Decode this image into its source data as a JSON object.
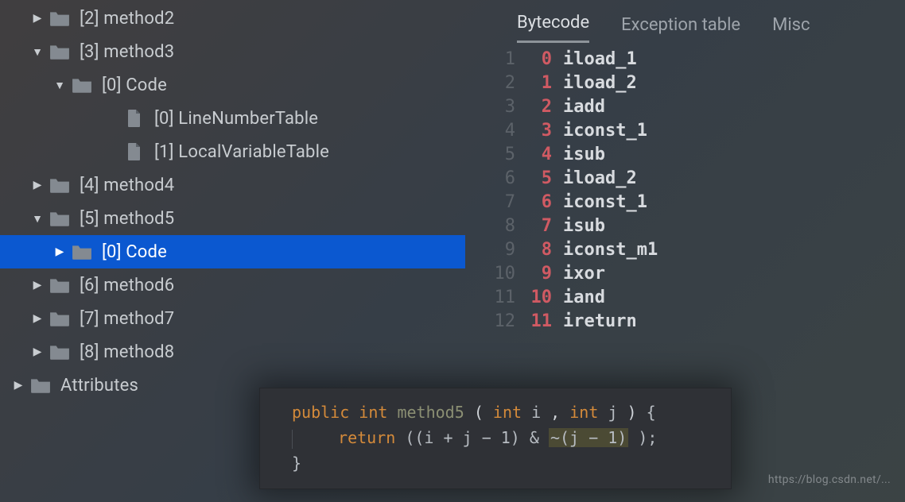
{
  "tree": {
    "rows": [
      {
        "indent": 1,
        "arrow": "right",
        "icon": "folder",
        "label": "[2] method2",
        "selected": false
      },
      {
        "indent": 1,
        "arrow": "down",
        "icon": "folder",
        "label": "[3] method3",
        "selected": false
      },
      {
        "indent": 2,
        "arrow": "down",
        "icon": "folder",
        "label": "[0] Code",
        "selected": false
      },
      {
        "indent": 3,
        "arrow": "blank",
        "icon": "file",
        "label": "[0] LineNumberTable",
        "selected": false
      },
      {
        "indent": 3,
        "arrow": "blank",
        "icon": "file",
        "label": "[1] LocalVariableTable",
        "selected": false
      },
      {
        "indent": 1,
        "arrow": "right",
        "icon": "folder",
        "label": "[4] method4",
        "selected": false
      },
      {
        "indent": 1,
        "arrow": "down",
        "icon": "folder",
        "label": "[5] method5",
        "selected": false
      },
      {
        "indent": 2,
        "arrow": "right",
        "icon": "folder",
        "label": "[0] Code",
        "selected": true
      },
      {
        "indent": 1,
        "arrow": "right",
        "icon": "folder",
        "label": "[6] method6",
        "selected": false
      },
      {
        "indent": 1,
        "arrow": "right",
        "icon": "folder",
        "label": "[7] method7",
        "selected": false
      },
      {
        "indent": 1,
        "arrow": "right",
        "icon": "folder",
        "label": "[8] method8",
        "selected": false
      },
      {
        "indent": 0,
        "arrow": "right",
        "icon": "folder",
        "label": "Attributes",
        "selected": false
      }
    ]
  },
  "tabs": {
    "items": [
      {
        "label": "Bytecode",
        "active": true
      },
      {
        "label": "Exception table",
        "active": false
      },
      {
        "label": "Misc",
        "active": false
      }
    ]
  },
  "bytecode": {
    "rows": [
      {
        "line": "1",
        "offset": "0",
        "instr": "iload_1"
      },
      {
        "line": "2",
        "offset": "1",
        "instr": "iload_2"
      },
      {
        "line": "3",
        "offset": "2",
        "instr": "iadd"
      },
      {
        "line": "4",
        "offset": "3",
        "instr": "iconst_1"
      },
      {
        "line": "5",
        "offset": "4",
        "instr": "isub"
      },
      {
        "line": "6",
        "offset": "5",
        "instr": "iload_2"
      },
      {
        "line": "7",
        "offset": "6",
        "instr": "iconst_1"
      },
      {
        "line": "8",
        "offset": "7",
        "instr": "isub"
      },
      {
        "line": "9",
        "offset": "8",
        "instr": "iconst_m1"
      },
      {
        "line": "10",
        "offset": "9",
        "instr": "ixor"
      },
      {
        "line": "11",
        "offset": "10",
        "instr": "iand"
      },
      {
        "line": "12",
        "offset": "11",
        "instr": "ireturn"
      }
    ]
  },
  "snippet": {
    "kw_public": "public",
    "ty_int": "int",
    "fn_name": "method5",
    "sig_open": "(",
    "ty_int2": "int",
    "p1": " i ",
    "comma": ",",
    "ty_int3": "int",
    "p2": " j",
    "sig_close": ")",
    "brace_open": "{",
    "kw_return": "return",
    "expr_pre": " ((i + j − 1) & ",
    "expr_hl": "~(j − 1)",
    "expr_post": ");",
    "brace_close": "}"
  },
  "watermark": "https://blog.csdn.net/..."
}
